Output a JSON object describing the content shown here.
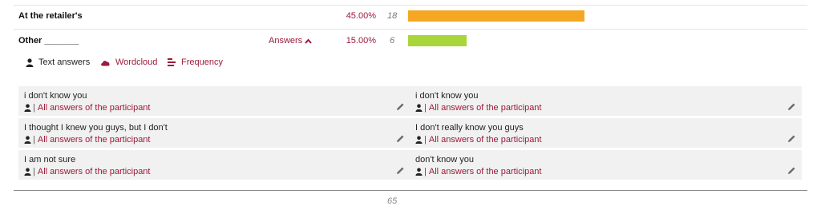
{
  "rows": [
    {
      "label": "At the retailer's",
      "percent": "45.00%",
      "count": "18",
      "share": 0.45,
      "color": "#f5a623"
    },
    {
      "label": "Other _______",
      "answers_label": "Answers",
      "percent": "15.00%",
      "count": "6",
      "share": 0.15,
      "color": "#a8d63a"
    }
  ],
  "tabs": [
    {
      "label": "Text answers",
      "icon": "user-icon"
    },
    {
      "label": "Wordcloud",
      "icon": "cloud-icon"
    },
    {
      "label": "Frequency",
      "icon": "bars-icon"
    }
  ],
  "answers": [
    {
      "text": "i don't know you",
      "separator": "|",
      "link": "All answers of the participant"
    },
    {
      "text": "i don't know you",
      "separator": "|",
      "link": "All answers of the participant"
    },
    {
      "text": "I thought I knew you guys, but I don't",
      "separator": "|",
      "link": "All answers of the participant"
    },
    {
      "text": "I don't really know you guys",
      "separator": "|",
      "link": "All answers of the participant"
    },
    {
      "text": "I am not sure",
      "separator": "|",
      "link": "All answers of the participant"
    },
    {
      "text": "don't know you",
      "separator": "|",
      "link": "All answers of the participant"
    }
  ],
  "total": "65",
  "colors": {
    "accent": "#9b1b3a"
  }
}
